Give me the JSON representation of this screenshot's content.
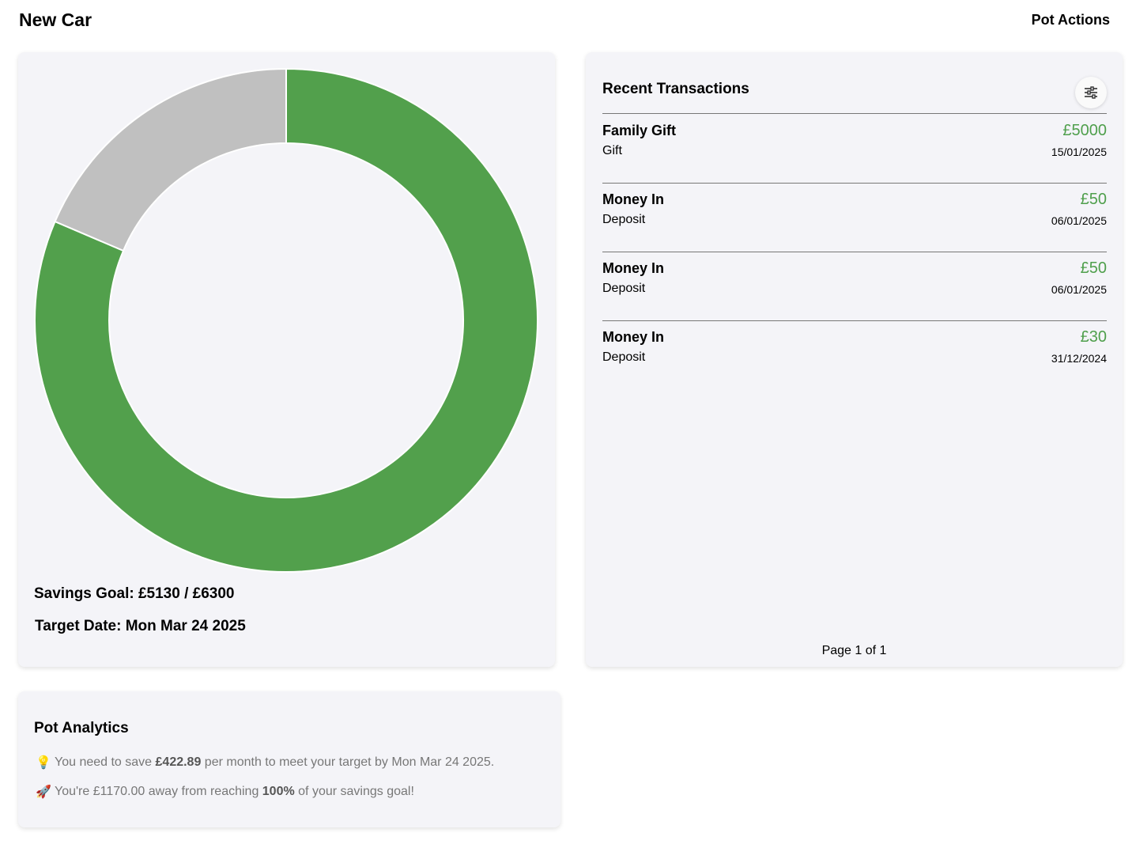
{
  "header": {
    "title": "New Car",
    "actions_label": "Pot Actions"
  },
  "progress": {
    "saved": 5130,
    "goal": 6300,
    "colors": {
      "saved": "#52a04c",
      "remaining": "#c0c0c0"
    },
    "goal_text": "Savings Goal: £5130 / £6300",
    "date_text": "Target Date: Mon Mar 24 2025"
  },
  "transactions": {
    "title": "Recent Transactions",
    "filter_icon": "sliders-icon",
    "items": [
      {
        "name": "Family Gift",
        "type": "Gift",
        "amount": "£5000",
        "date": "15/01/2025"
      },
      {
        "name": "Money In",
        "type": "Deposit",
        "amount": "£50",
        "date": "06/01/2025"
      },
      {
        "name": "Money In",
        "type": "Deposit",
        "amount": "£50",
        "date": "06/01/2025"
      },
      {
        "name": "Money In",
        "type": "Deposit",
        "amount": "£30",
        "date": "31/12/2024"
      }
    ],
    "pager": "Page 1 of 1"
  },
  "analytics": {
    "title": "Pot Analytics",
    "line1": {
      "icon": "lightbulb-icon",
      "glyph": "💡",
      "pre": "You need to save ",
      "bold": "£422.89",
      "post": " per month to meet your target by Mon Mar 24 2025."
    },
    "line2": {
      "icon": "rocket-icon",
      "glyph": "🚀",
      "pre": "You're £1170.00 away from reaching ",
      "bold": "100%",
      "post": " of your savings goal!"
    }
  }
}
